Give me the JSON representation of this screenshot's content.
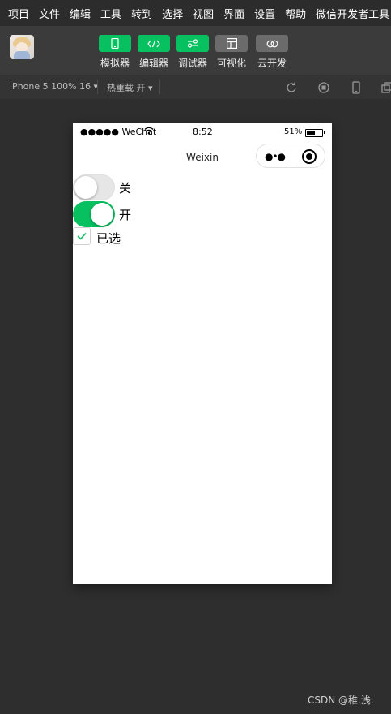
{
  "menu": [
    "项目",
    "文件",
    "编辑",
    "工具",
    "转到",
    "选择",
    "视图",
    "界面",
    "设置",
    "帮助",
    "微信开发者工具"
  ],
  "toolbar": {
    "simulator": "模拟器",
    "editor": "编辑器",
    "debugger": "调试器",
    "visualize": "可视化",
    "cloud": "云开发"
  },
  "subbar": {
    "device": "iPhone 5 100% 16 ▾",
    "hotreload": "热重载 开 ▾"
  },
  "phone": {
    "signal": "●●●●● WeChat",
    "time": "8:52",
    "battery": "51%",
    "nav_title": "Weixin",
    "switch_off_label": "关",
    "switch_on_label": "开",
    "checkbox_label": "已选"
  },
  "watermark": "CSDN @稚.浅.",
  "colors": {
    "accent": "#07c160",
    "background": "#2e2e2e"
  },
  "states": {
    "switch1_on": false,
    "switch2_on": true,
    "checkbox_checked": true
  }
}
